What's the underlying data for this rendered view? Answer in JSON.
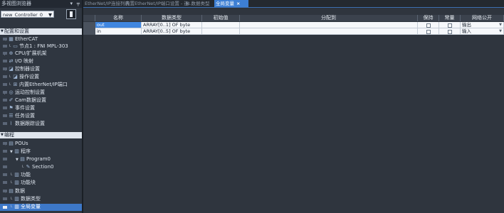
{
  "sidebar": {
    "title": "多视图浏览器",
    "controller": "new_Controller_0",
    "config_section": "配置和设置",
    "program_section": "编程",
    "config_items": [
      {
        "label": "EtherCAT",
        "icon": "ethercat-icon"
      },
      {
        "label": "节点1 : FNI MPL-303",
        "icon": "node-icon"
      },
      {
        "label": "CPU/扩展机架",
        "icon": "cpu-rack-icon"
      },
      {
        "label": "I/O 映射",
        "icon": "io-map-icon"
      },
      {
        "label": "控制器设置",
        "icon": "controller-settings-icon"
      },
      {
        "label": "操作设置",
        "icon": "operation-settings-icon"
      },
      {
        "label": "内置EtherNet/IP端口",
        "icon": "ethernet-port-icon"
      },
      {
        "label": "运动控制设置",
        "icon": "motion-icon"
      },
      {
        "label": "Cam数据设置",
        "icon": "cam-icon"
      },
      {
        "label": "事件设置",
        "icon": "event-icon"
      },
      {
        "label": "任务设置",
        "icon": "task-icon"
      },
      {
        "label": "数据跟踪设置",
        "icon": "trace-icon"
      }
    ],
    "program_items": [
      {
        "label": "POUs",
        "icon": "pous-icon"
      },
      {
        "label": "程序",
        "icon": "program-folder-icon"
      },
      {
        "label": "Program0",
        "icon": "program-icon"
      },
      {
        "label": "Section0",
        "icon": "section-icon"
      },
      {
        "label": "功能",
        "icon": "function-icon"
      },
      {
        "label": "功能块",
        "icon": "function-block-icon"
      },
      {
        "label": "数据",
        "icon": "data-icon"
      },
      {
        "label": "数据类型",
        "icon": "data-type-icon"
      },
      {
        "label": "全局变量",
        "icon": "global-var-icon"
      }
    ]
  },
  "tabs": [
    {
      "label": "EtherNet/IP连接列表"
    },
    {
      "label": "内置EtherNet/IP端口设置 - 连..."
    },
    {
      "label": "数据类型"
    },
    {
      "label": "全局变量",
      "close": "×"
    }
  ],
  "table": {
    "headers": [
      "名称",
      "数据类型",
      "初始值",
      "分配到",
      "保持",
      "常量",
      "网络公开"
    ],
    "rows": [
      {
        "name": "out",
        "type": "ARRAY[0..1] OF byte",
        "initial": "",
        "assign": "",
        "retain": false,
        "constant": false,
        "network": "输出"
      },
      {
        "name": "in",
        "type": "ARRAY[0..5] OF byte",
        "initial": "",
        "assign": "",
        "retain": false,
        "constant": false,
        "network": "输入"
      }
    ]
  },
  "colors": {
    "background": "#2b313a",
    "active_tab": "#3d7fd4",
    "selection": "#3d78c8"
  }
}
